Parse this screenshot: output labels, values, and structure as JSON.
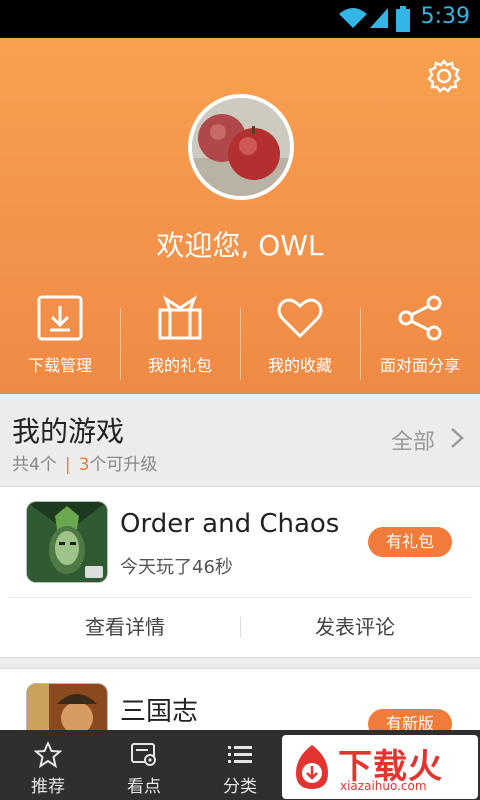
{
  "status_bar": {
    "time": "5:39"
  },
  "profile": {
    "welcome": "欢迎您, OWL"
  },
  "actions": [
    {
      "label": "下载管理",
      "icon": "download-icon"
    },
    {
      "label": "我的礼包",
      "icon": "gift-icon"
    },
    {
      "label": "我的收藏",
      "icon": "heart-icon"
    },
    {
      "label": "面对面分享",
      "icon": "share-icon"
    }
  ],
  "my_games": {
    "title": "我的游戏",
    "total": "共4个",
    "upgrade_count": "3",
    "upgrade_text": "个可升级",
    "view_all": "全部"
  },
  "games": [
    {
      "name": "Order and Chaos",
      "meta": "今天玩了46秒",
      "badge": "有礼包",
      "details_button": "查看详情",
      "review_button": "发表评论"
    },
    {
      "name": "三国志",
      "badge": "有新版"
    }
  ],
  "bottom_nav": [
    {
      "label": "推荐",
      "icon": "star-icon"
    },
    {
      "label": "看点",
      "icon": "view-icon"
    },
    {
      "label": "分类",
      "icon": "list-icon"
    }
  ],
  "watermark": {
    "text": "下载火",
    "url": "xiazaihuo.com"
  },
  "colors": {
    "accent": "#f07b3a",
    "header_top": "#f7a14f",
    "header_bottom": "#ef8a45",
    "nav_bg": "#2f2f2f"
  }
}
